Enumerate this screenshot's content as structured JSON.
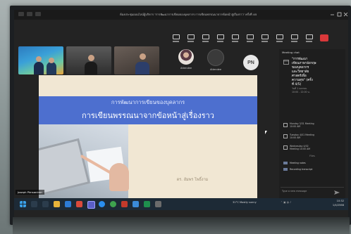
{
  "window": {
    "title": "ห้องประชุมออนไลน์ผู้บริหาร \"การพัฒนาการเขียนของบุคลากร การเขียนพรรณนาจากข้อหน้าสู่เรื่องราว\" ครั้งที่ 4/5"
  },
  "toolbar": {
    "items": [
      {
        "label": "Chat",
        "icon": "chat-icon"
      },
      {
        "label": "People",
        "icon": "people-icon"
      },
      {
        "label": "React",
        "icon": "react-icon"
      },
      {
        "label": "View",
        "icon": "view-icon"
      },
      {
        "label": "Rooms",
        "icon": "rooms-icon"
      },
      {
        "label": "Apps",
        "icon": "apps-icon"
      },
      {
        "label": "More",
        "icon": "more-icon"
      },
      {
        "label": "Camera",
        "icon": "camera-icon"
      },
      {
        "label": "Mic",
        "icon": "mic-icon"
      },
      {
        "label": "Share",
        "icon": "share-icon"
      }
    ],
    "leave_label": ""
  },
  "participants": [
    {
      "name": "Attendee",
      "avatar": "person"
    },
    {
      "name": "Attendee",
      "avatar": "dark"
    }
  ],
  "participant_initials": "PN",
  "slide": {
    "subtitle": "การพัฒนาการเขียนของบุคลากร",
    "title": "การเขียนพรรณนาจากข้อหน้าสู่เรื่องราว",
    "author": "ดร. อัมพร โพธิ์งาม"
  },
  "speaker_tag": "Joseph Pimsaniran",
  "chat": {
    "header": "Meeting chat",
    "card_lines": [
      "\"การพัฒนา",
      "เขียนภาษาอังกฤษ",
      "ของบุคลากร",
      "และวิทยาลัย",
      "ศาสตร์เพื่อ",
      "ความสุข\" (ครั้ง",
      "ที่ 4/5)"
    ],
    "card_meta": [
      "วันที่ 1 เมษายน",
      "10:00 - 12:00 น."
    ],
    "schedule": [
      {
        "text": "Monday 3/31 Meeting 10:00 AM"
      },
      {
        "text": "Tuesday 4/01 Meeting 10:00 AM"
      },
      {
        "text": "Wednesday 4/02 Meeting 10:00 AM"
      }
    ],
    "separator": "Files",
    "files": [
      {
        "name": "Meeting notes"
      },
      {
        "name": "Recording transcript"
      }
    ],
    "input_placeholder": "Type a new message"
  },
  "taskbar": {
    "weather": "31°C Mostly sunny",
    "clock": "10:32",
    "date": "1/4/2568"
  },
  "colors": {
    "slide_banner": "#4d6fcf",
    "slide_bg": "#f1e7d3",
    "leave": "#d9383a",
    "taskbar": "#1d2a36"
  }
}
